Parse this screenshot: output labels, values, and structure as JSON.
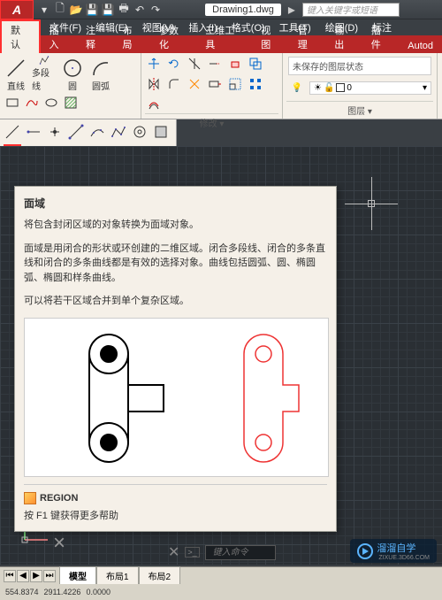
{
  "title_bar": {
    "drawing_name": "Drawing1.dwg",
    "search_placeholder": "键入关键字或短语"
  },
  "menu": {
    "file": "文件(F)",
    "edit": "编辑(E)",
    "view": "视图(V)",
    "insert": "插入(I)",
    "format": "格式(O)",
    "tools": "工具(T)",
    "draw": "绘图(D)",
    "dim": "标注"
  },
  "ribbon_tabs": {
    "default": "默认",
    "insert": "插入",
    "annotate": "注释",
    "layout": "布局",
    "parametric": "参数化",
    "tools3d": "三维工具",
    "view": "视图",
    "manage": "管理",
    "output": "输出",
    "plugins": "插件",
    "autod": "Autod"
  },
  "draw_panel": {
    "line": "直线",
    "polyline": "多段线",
    "circle": "圆",
    "arc": "圆弧"
  },
  "panel_titles": {
    "modify": "修改 ▾",
    "layer": "图层 ▾"
  },
  "layer": {
    "unsaved": "未保存的图层状态",
    "layer0": "0"
  },
  "tooltip": {
    "title": "面域",
    "p1": "将包含封闭区域的对象转换为面域对象。",
    "p2": "面域是用闭合的形状或环创建的二维区域。闭合多段线、闭合的多条直线和闭合的多条曲线都是有效的选择对象。曲线包括圆弧、圆、椭圆弧、椭圆和样条曲线。",
    "p3": "可以将若干区域合并到单个复杂区域。",
    "command": "REGION",
    "f1": "按 F1 键获得更多帮助"
  },
  "tabs": {
    "model": "模型",
    "layout1": "布局1",
    "layout2": "布局2"
  },
  "command_line": {
    "placeholder": "键入命令"
  },
  "status": {
    "coord1": "554.8374",
    "coord2": "2911.4226",
    "coord3": "0.0000"
  },
  "watermark": {
    "text": "溜溜自学",
    "url": "ZIXUE.3D66.COM"
  },
  "icons": {
    "new": "new-icon",
    "open": "open-icon",
    "save": "save-icon",
    "undo": "undo-icon",
    "redo": "redo-icon",
    "print": "print-icon",
    "line": "line-icon",
    "polyline": "polyline-icon",
    "circle": "circle-icon",
    "arc": "arc-icon",
    "move": "move-icon",
    "rotate": "rotate-icon",
    "trim": "trim-icon",
    "copy": "copy-icon",
    "mirror": "mirror-icon",
    "fillet": "fillet-icon",
    "stretch": "stretch-icon",
    "scale": "scale-icon",
    "array": "array-icon",
    "region": "region-icon"
  }
}
